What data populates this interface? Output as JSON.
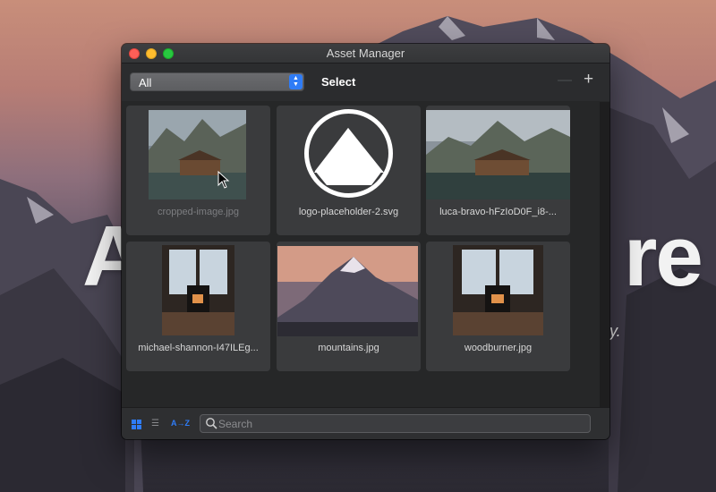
{
  "background": {
    "word_left": "A",
    "word_right": "re",
    "tagline_mark": "y."
  },
  "window": {
    "title": "Asset Manager",
    "controls": [
      "close",
      "minimize",
      "zoom"
    ]
  },
  "toolbar": {
    "filter_value": "All",
    "select_label": "Select",
    "remove_label": "—",
    "add_label": "+"
  },
  "assets": [
    {
      "name": "cropped-image.jpg",
      "dimmed": true
    },
    {
      "name": "logo-placeholder-2.svg",
      "dimmed": false
    },
    {
      "name": "luca-bravo-hFzIoD0F_i8-...",
      "dimmed": false
    },
    {
      "name": "michael-shannon-I47ILEg...",
      "dimmed": false
    },
    {
      "name": "mountains.jpg",
      "dimmed": false
    },
    {
      "name": "woodburner.jpg",
      "dimmed": false
    }
  ],
  "bottombar": {
    "grid_view_icon": "grid-icon",
    "list_view_icon": "list-icon",
    "sort_label": "A→Z",
    "search_placeholder": "Search"
  },
  "colors": {
    "accent": "#2f7cf6",
    "window_bg": "#262728",
    "tile_bg": "#3a3b3d"
  }
}
